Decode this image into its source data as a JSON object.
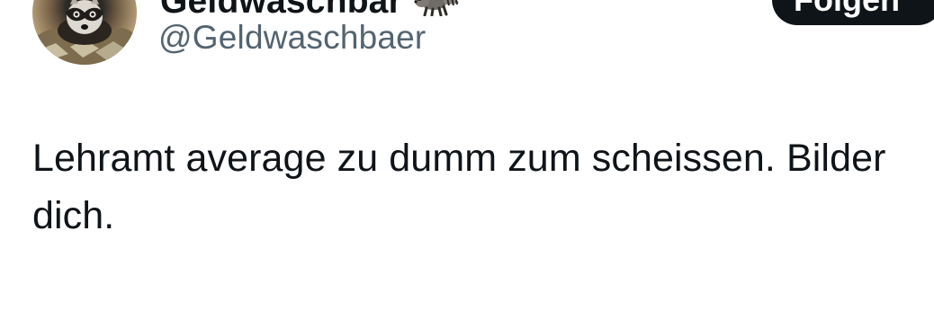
{
  "author": {
    "display_name": "Geldwaschbär",
    "handle": "@Geldwaschbaer",
    "display_name_emoji": "raccoon-emoji",
    "avatar_icon": "raccoon-avatar-icon"
  },
  "actions": {
    "follow_label": "Folgen"
  },
  "tweet": {
    "text": "Lehramt average zu dumm zum scheissen. Bilder dich."
  },
  "colors": {
    "text_primary": "#0f1419",
    "text_secondary": "#536471",
    "button_background": "#0f1419",
    "button_text": "#ffffff",
    "page_background": "#ffffff"
  }
}
